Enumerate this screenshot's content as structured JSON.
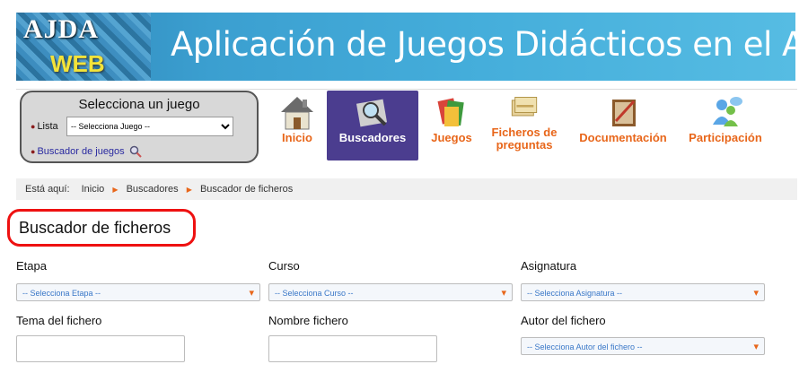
{
  "banner": {
    "logo_top": "AJDA",
    "logo_bottom": "WEB",
    "title": "Aplicación de Juegos Didácticos en el Aula"
  },
  "selector": {
    "title": "Selecciona un juego",
    "lista_label": "Lista",
    "lista_value": "-- Selecciona Juego --",
    "buscador_label": "Buscador de juegos"
  },
  "nav": {
    "inicio": "Inicio",
    "buscadores": "Buscadores",
    "juegos": "Juegos",
    "ficheros_1": "Ficheros de",
    "ficheros_2": "preguntas",
    "documentacion": "Documentación",
    "participacion": "Participación"
  },
  "breadcrumb": {
    "prefix": "Está aquí:",
    "items": [
      "Inicio",
      "Buscadores",
      "Buscador de ficheros"
    ]
  },
  "page_title": "Buscador de ficheros",
  "form": {
    "etapa_label": "Etapa",
    "etapa_value": "-- Selecciona Etapa --",
    "curso_label": "Curso",
    "curso_value": "-- Selecciona Curso --",
    "asignatura_label": "Asignatura",
    "asignatura_value": "-- Selecciona Asignatura --",
    "tema_label": "Tema del fichero",
    "tema_value": "",
    "nombre_label": "Nombre fichero",
    "nombre_value": "",
    "autor_label": "Autor del fichero",
    "autor_value": "-- Selecciona Autor del fichero --"
  },
  "colors": {
    "accent": "#e8661a",
    "nav_active": "#4b3d8f",
    "highlight_ring": "#ee1111"
  }
}
